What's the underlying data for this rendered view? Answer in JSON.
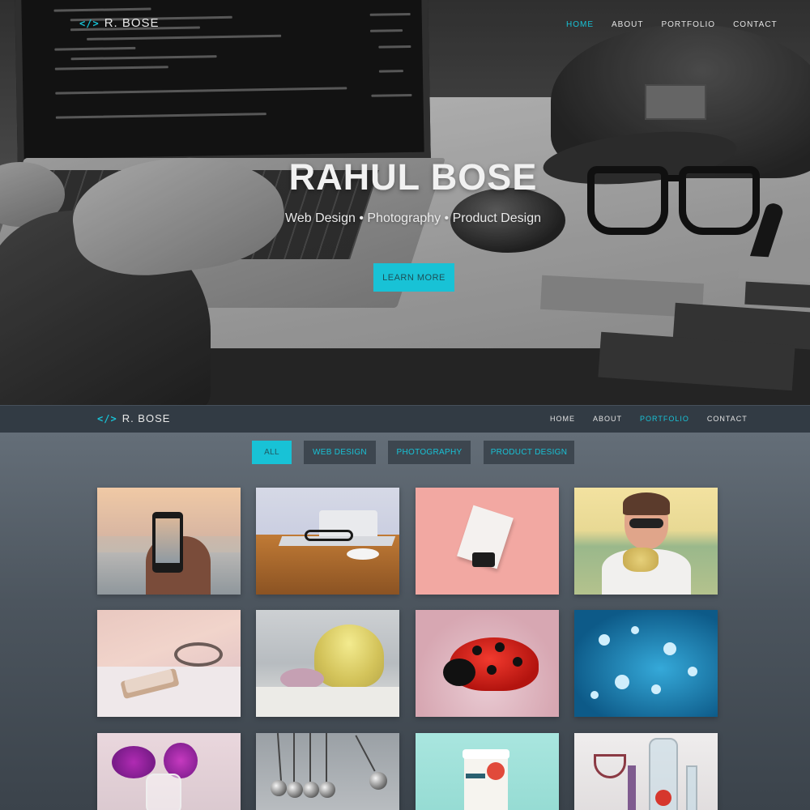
{
  "brand": {
    "name": "R. BOSE",
    "icon": "code-icon"
  },
  "hero_nav": {
    "items": [
      {
        "label": "HOME",
        "active": true
      },
      {
        "label": "ABOUT",
        "active": false
      },
      {
        "label": "PORTFOLIO",
        "active": false
      },
      {
        "label": "CONTACT",
        "active": false
      }
    ]
  },
  "hero": {
    "title": "RAHUL BOSE",
    "subtitle": "Web Design • Photography • Product Design",
    "button_label": "LEARN MORE"
  },
  "sticky_nav": {
    "items": [
      {
        "label": "HOME",
        "active": false
      },
      {
        "label": "ABOUT",
        "active": false
      },
      {
        "label": "PORTFOLIO",
        "active": true
      },
      {
        "label": "CONTACT",
        "active": false
      }
    ]
  },
  "portfolio": {
    "filters": [
      {
        "label": "ALL",
        "active": true
      },
      {
        "label": "WEB DESIGN",
        "active": false
      },
      {
        "label": "PHOTOGRAPHY",
        "active": false
      },
      {
        "label": "PRODUCT DESIGN",
        "active": false
      }
    ],
    "items": [
      {
        "subject": "phone-in-hand-at-sunset"
      },
      {
        "subject": "laptop-and-glasses-on-desk"
      },
      {
        "subject": "business-card-on-clip"
      },
      {
        "subject": "woman-with-sunglasses-in-field"
      },
      {
        "subject": "phone-and-glasses-on-table"
      },
      {
        "subject": "seashells-on-sand"
      },
      {
        "subject": "ladybug-closeup"
      },
      {
        "subject": "water-droplets-on-dandelion"
      },
      {
        "subject": "purple-flowers-in-vase"
      },
      {
        "subject": "newtons-cradle"
      },
      {
        "subject": "coffee-cup-mockup"
      },
      {
        "subject": "glass-bottles-still-life"
      }
    ]
  },
  "colors": {
    "accent": "#18c2d6",
    "nav_bar": "#323b44",
    "filter_bg": "#3d464f"
  }
}
